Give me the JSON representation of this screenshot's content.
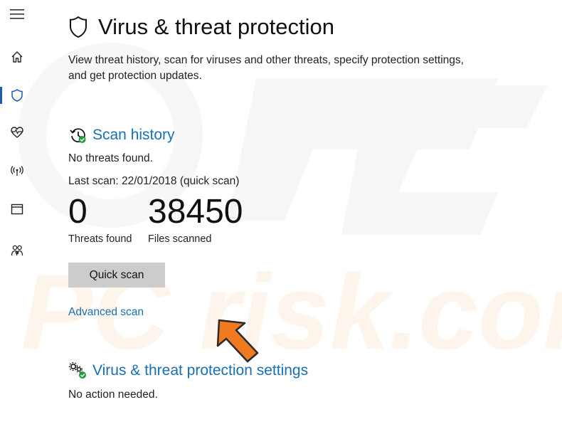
{
  "sidebar": {
    "items": [
      {
        "icon": "home-icon"
      },
      {
        "icon": "shield-icon",
        "active": true
      },
      {
        "icon": "heart-pulse-icon"
      },
      {
        "icon": "wifi-antenna-icon"
      },
      {
        "icon": "browser-window-icon"
      },
      {
        "icon": "family-icon"
      }
    ]
  },
  "page": {
    "title": "Virus & threat protection",
    "description": "View threat history, scan for viruses and other threats, specify protection settings, and get protection updates."
  },
  "scan_history": {
    "heading": "Scan history",
    "status": "No threats found.",
    "last_scan": "Last scan: 22/01/2018 (quick scan)",
    "threats_found_value": "0",
    "threats_found_label": "Threats found",
    "files_scanned_value": "38450",
    "files_scanned_label": "Files scanned",
    "quick_scan_label": "Quick scan",
    "advanced_scan_label": "Advanced scan"
  },
  "settings": {
    "heading": "Virus & threat protection settings",
    "status": "No action needed."
  },
  "watermark": {
    "text": "PC risk.com"
  },
  "colors": {
    "accent": "#1a6fb5",
    "nav_active": "#1a5fb4",
    "button_bg": "#cccccc",
    "arrow": "#f07a20",
    "ok_badge": "#1e9e3a"
  }
}
